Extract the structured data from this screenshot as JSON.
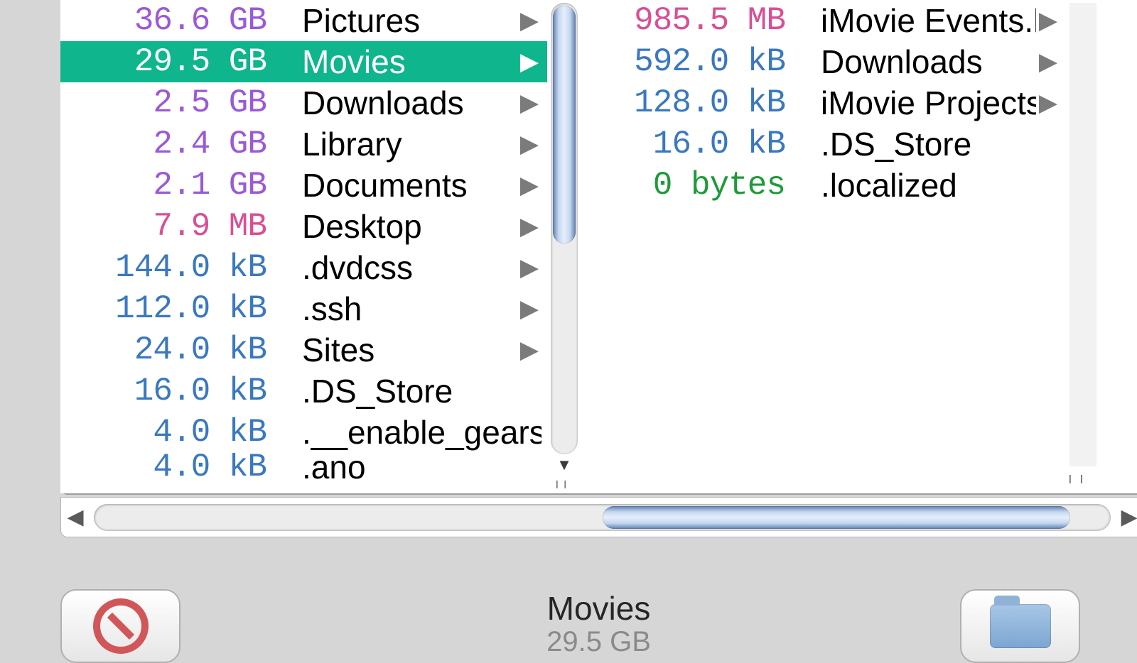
{
  "selection": {
    "name": "Movies",
    "size": "29.5 GB"
  },
  "left_column": [
    {
      "size": "36.6 GB",
      "name": "Pictures",
      "tier": "gb",
      "dir": true,
      "selected": false
    },
    {
      "size": "29.5 GB",
      "name": "Movies",
      "tier": "gb",
      "dir": true,
      "selected": true
    },
    {
      "size": "2.5 GB",
      "name": "Downloads",
      "tier": "gb",
      "dir": true,
      "selected": false
    },
    {
      "size": "2.4 GB",
      "name": "Library",
      "tier": "gb",
      "dir": true,
      "selected": false
    },
    {
      "size": "2.1 GB",
      "name": "Documents",
      "tier": "gb",
      "dir": true,
      "selected": false
    },
    {
      "size": "7.9 MB",
      "name": "Desktop",
      "tier": "mb",
      "dir": true,
      "selected": false
    },
    {
      "size": "144.0 kB",
      "name": ".dvdcss",
      "tier": "kb",
      "dir": true,
      "selected": false
    },
    {
      "size": "112.0 kB",
      "name": ".ssh",
      "tier": "kb",
      "dir": true,
      "selected": false
    },
    {
      "size": "24.0 kB",
      "name": "Sites",
      "tier": "kb",
      "dir": true,
      "selected": false
    },
    {
      "size": "16.0 kB",
      "name": ".DS_Store",
      "tier": "kb",
      "dir": false,
      "selected": false
    },
    {
      "size": "4.0 kB",
      "name": ".__enable_gears_st…",
      "tier": "kb",
      "dir": false,
      "selected": false
    },
    {
      "size": "4.0 kB",
      "name": ".ano",
      "tier": "kb",
      "dir": false,
      "selected": false,
      "clipped": true
    }
  ],
  "right_column": [
    {
      "size": "985.5 MB",
      "name": "iMovie Events.loc",
      "tier": "mb",
      "dir": true
    },
    {
      "size": "592.0 kB",
      "name": "Downloads",
      "tier": "kb",
      "dir": true
    },
    {
      "size": "128.0 kB",
      "name": "iMovie Projects.lo",
      "tier": "kb",
      "dir": true
    },
    {
      "size": "16.0 kB",
      "name": ".DS_Store",
      "tier": "kb",
      "dir": false
    },
    {
      "size": "0 bytes",
      "name": ".localized",
      "tier": "by",
      "dir": false
    }
  ],
  "glyphs": {
    "arrow_right": "▶",
    "arrow_down": "▼",
    "arrow_left": "◀",
    "grip_v": "ıı",
    "grip_h": "ıı"
  }
}
